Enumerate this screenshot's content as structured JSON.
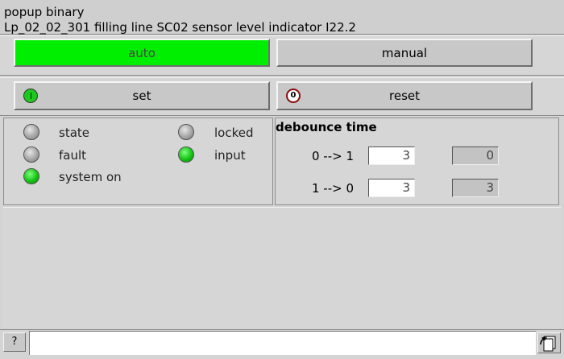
{
  "header": {
    "title": "popup binary",
    "subtitle": "Lp_02_02_301 filling line SC02 sensor level indicator I22.2"
  },
  "mode": {
    "auto_label": "auto",
    "manual_label": "manual",
    "auto_active": true
  },
  "actions": {
    "set_label": "set",
    "reset_label": "reset",
    "reset_led_text": "0"
  },
  "indicators": {
    "state": "state",
    "fault": "fault",
    "system_on": "system on",
    "locked": "locked",
    "input": "input"
  },
  "debounce": {
    "title": "debounce time",
    "rows": [
      {
        "label": "0 --> 1",
        "setpoint": "3",
        "actual": "0"
      },
      {
        "label": "1 --> 0",
        "setpoint": "3",
        "actual": "3"
      }
    ]
  },
  "statusbar": {
    "help_label": "?",
    "message": ""
  },
  "colors": {
    "active_green": "#00ee00",
    "led_green": "#14c414",
    "led_gray": "#a6a6a6",
    "reset_ring": "#8a0d0d"
  },
  "icons": {
    "set_led": "green-led-icon",
    "reset_led": "zero-ring-icon",
    "nav": "window-switch-icon"
  }
}
